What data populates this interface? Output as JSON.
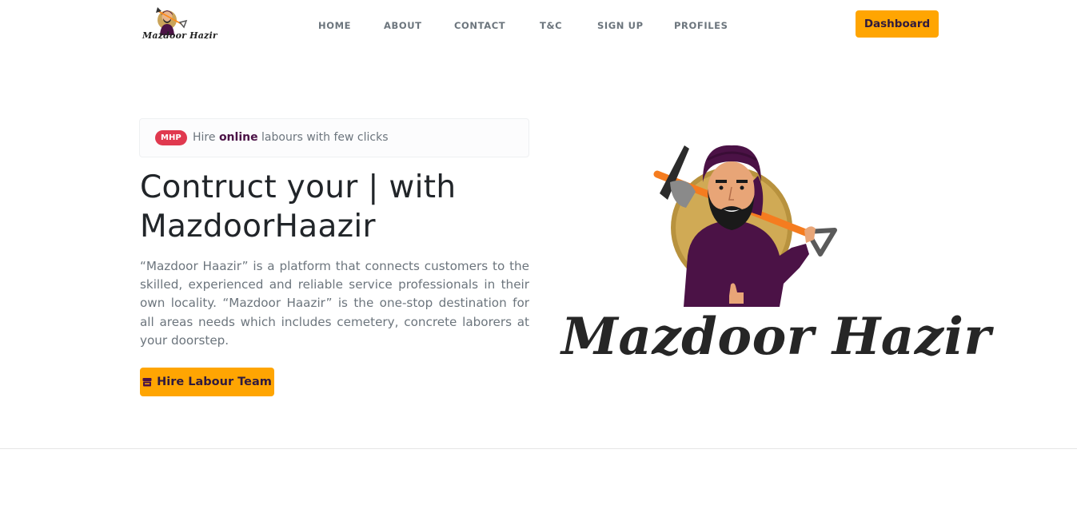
{
  "header": {
    "logo_text": "Mazdoor Hazir",
    "nav": [
      {
        "label": "HOME"
      },
      {
        "label": "ABOUT"
      },
      {
        "label": "CONTACT"
      },
      {
        "label": "T&C"
      },
      {
        "label": "SIGN UP"
      },
      {
        "label": "PROFILES"
      }
    ],
    "dashboard_label": "Dashboard"
  },
  "hero": {
    "badge": "MHP",
    "tagline_before": "Hire ",
    "tagline_highlight": "online",
    "tagline_after": " labours with few clicks",
    "title_line1": "Contruct your | with",
    "title_line2": "MazdoorHaazir",
    "description": "“Mazdoor Haazir” is a platform that connects customers to the skilled, experienced and reliable service professionals in their own locality. “Mazdoor Haazir” is the one-stop destination for all areas needs which includes cemetery, concrete laborers at your doorstep.",
    "cta_label": "Hire Labour Team",
    "cta_icon": "store-icon"
  },
  "brand": {
    "wordmark": "Mazdoor Hazir",
    "illustration_icon": "worker-with-pickaxe-icon"
  },
  "colors": {
    "accent": "#ffa502",
    "badge": "#e0394f",
    "highlight": "#4b1246",
    "text_muted": "#6c757d",
    "text_dark": "#212529"
  }
}
